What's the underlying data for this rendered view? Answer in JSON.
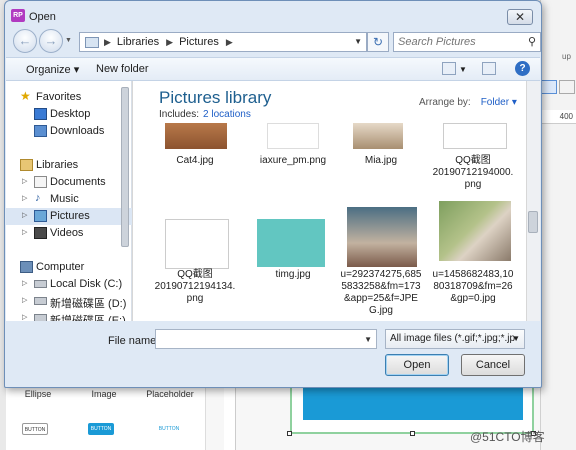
{
  "dialog": {
    "title": "Open",
    "app_icon_text": "RP",
    "close_label": "✕"
  },
  "nav": {
    "back": "←",
    "forward": "→",
    "breadcrumbs": [
      "Libraries",
      "Pictures"
    ],
    "refresh": "↻",
    "search_placeholder": "Search Pictures"
  },
  "toolbar": {
    "organize": "Organize ▾",
    "new_folder": "New folder",
    "help": "?"
  },
  "sidebar": {
    "items": [
      {
        "label": "Favorites"
      },
      {
        "label": "Desktop"
      },
      {
        "label": "Downloads"
      },
      {
        "label": "Libraries"
      },
      {
        "label": "Documents"
      },
      {
        "label": "Music"
      },
      {
        "label": "Pictures"
      },
      {
        "label": "Videos"
      },
      {
        "label": "Computer"
      },
      {
        "label": "Local Disk (C:)"
      },
      {
        "label": "新增磁碟區 (D:)"
      },
      {
        "label": "新增磁碟區 (E:)"
      }
    ]
  },
  "content": {
    "title": "Pictures library",
    "includes_label": "Includes:",
    "includes_link": "2 locations",
    "arrange_label": "Arrange by:",
    "arrange_value": "Folder ▾",
    "files": [
      {
        "name": "Cat4.jpg"
      },
      {
        "name": "iaxure_pm.png"
      },
      {
        "name": "Mia.jpg"
      },
      {
        "name": "QQ截图\n20190712194000.\npng"
      },
      {
        "name": "QQ截图\n20190712194134.\npng"
      },
      {
        "name": "timg.jpg"
      },
      {
        "name": "u=292374275,685\n5833258&fm=173\n&app=25&f=JPE\nG.jpg"
      },
      {
        "name": "u=1458682483,10\n80318709&fm=26\n&gp=0.jpg"
      }
    ]
  },
  "footer": {
    "file_name_label": "File name:",
    "file_name_value": "",
    "filter": "All image files (*.gif;*.jpg;*.jp",
    "open": "Open",
    "cancel": "Cancel"
  },
  "background": {
    "library_items": [
      "Ellipse",
      "Image",
      "Placeholder"
    ],
    "mini_buttons": [
      "BUTTON",
      "BUTTON",
      "BUTTON"
    ],
    "ruler_value": "400",
    "up_label": "up",
    "watermark": "@51CTO博客"
  },
  "colors": {
    "accent": "#1f5fc7",
    "title_blue": "#1e5f8f",
    "selection": "#dbe6f4",
    "canvas_blue": "#1a9ad6",
    "rp_purple": "#b13ac1"
  }
}
